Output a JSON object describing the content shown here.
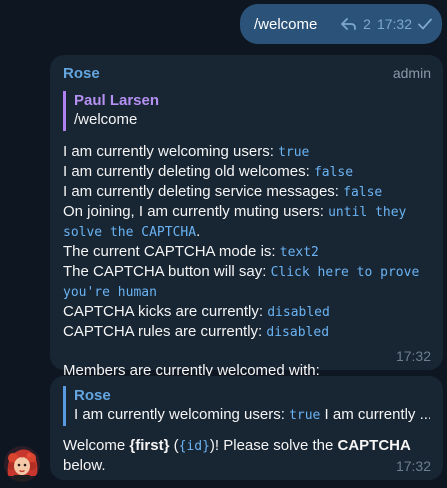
{
  "outgoing": {
    "text": "/welcome",
    "reply_count": "2",
    "time": "17:32"
  },
  "message1": {
    "sender": "Rose",
    "role": "admin",
    "reply": {
      "name": "Paul Larsen",
      "text": "/welcome"
    },
    "lines": {
      "l1_label": "I am currently welcoming users: ",
      "l1_value": "true",
      "l2_label": "I am currently deleting old welcomes: ",
      "l2_value": "false",
      "l3_label": "I am currently deleting service messages: ",
      "l3_value": "false",
      "l4_label": "On joining, I am currently muting users: ",
      "l4_value_a": "until they",
      "l4_value_b": "solve the CAPTCHA",
      "l4_suffix": ".",
      "l5_label": "The current CAPTCHA mode is: ",
      "l5_value": "text2",
      "l6_label": "The CAPTCHA button will say: ",
      "l6_value_a": "Click here to prove",
      "l6_value_b": "you're human",
      "l7_label": "CAPTCHA kicks are currently: ",
      "l7_value": "disabled",
      "l8_label": "CAPTCHA rules are currently: ",
      "l8_value": "disabled",
      "l9": "Members are currently welcomed with:"
    },
    "time": "17:32"
  },
  "message2": {
    "reply": {
      "name": "Rose",
      "text_a": "I am currently welcoming users: ",
      "text_value": "true",
      "text_b": " I am currently ..."
    },
    "body": {
      "p1": "Welcome ",
      "p2": "{first}",
      "p3": " (",
      "p4": "{id}",
      "p5": ")! Please solve the ",
      "p6": "CAPTCHA",
      "p7": "below."
    },
    "time": "17:32"
  },
  "colors": {
    "background": "#0e1621",
    "outgoing_bubble": "#2b5278",
    "incoming_bubble": "#182533",
    "sender_name": "#63a6e0",
    "reply_name": "#b490f2",
    "code": "#6ab3f3"
  },
  "icons": {
    "reply": "reply-arrow-icon",
    "read": "check-icon",
    "avatar": "rose-avatar"
  }
}
